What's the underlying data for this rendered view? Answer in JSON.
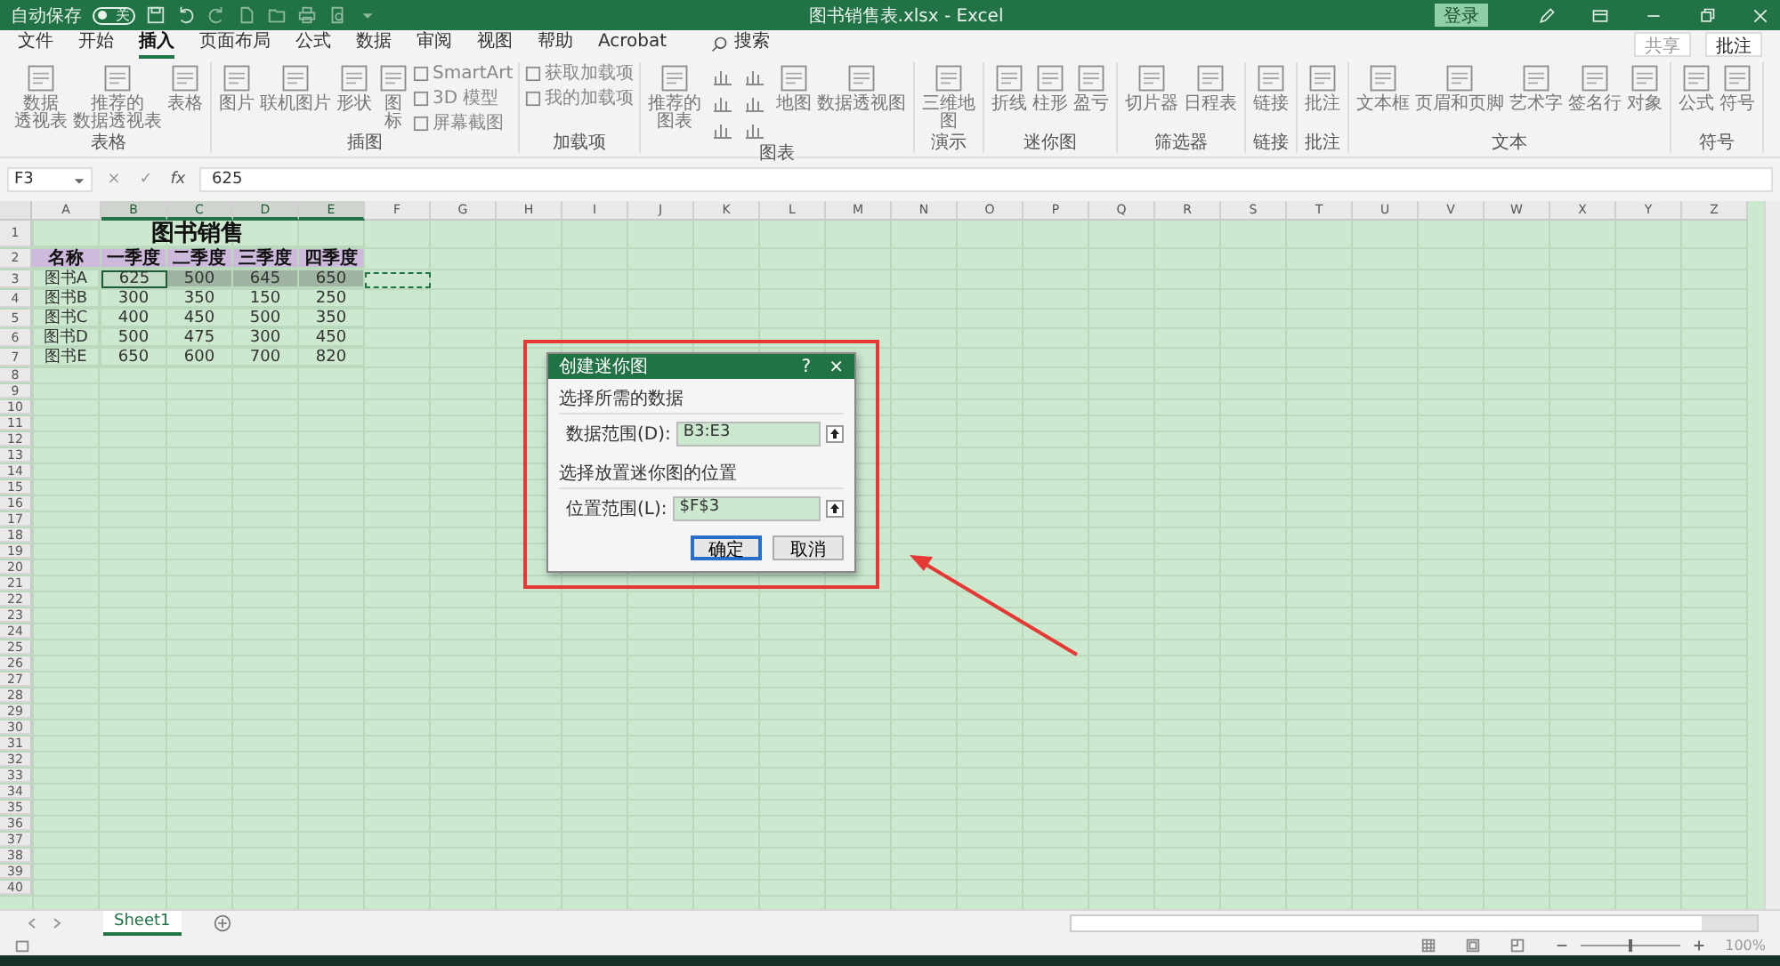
{
  "title_bar": {
    "autosave": {
      "label": "自动保存",
      "on": false,
      "state_text": "关"
    },
    "title": "图书销售表.xlsx - Excel",
    "sign_in": "登录"
  },
  "tabs": [
    {
      "label": "文件",
      "selected": false
    },
    {
      "label": "开始",
      "selected": false
    },
    {
      "label": "插入",
      "selected": true
    },
    {
      "label": "页面布局",
      "selected": false
    },
    {
      "label": "公式",
      "selected": false
    },
    {
      "label": "数据",
      "selected": false
    },
    {
      "label": "审阅",
      "selected": false
    },
    {
      "label": "视图",
      "selected": false
    },
    {
      "label": "帮助",
      "selected": false
    },
    {
      "label": "Acrobat",
      "selected": false
    }
  ],
  "search": {
    "label": "搜索"
  },
  "share": "共享",
  "comments": "批注",
  "ribbon": [
    {
      "label": "表格",
      "items": [
        {
          "kind": "large",
          "lines": [
            "数据",
            "透视表"
          ]
        },
        {
          "kind": "large",
          "lines": [
            "推荐的",
            "数据透视表"
          ]
        },
        {
          "kind": "large",
          "lines": [
            "表格"
          ]
        }
      ]
    },
    {
      "label": "插图",
      "items": [
        {
          "kind": "large",
          "lines": [
            "图片"
          ]
        },
        {
          "kind": "large",
          "lines": [
            "联机图片"
          ]
        },
        {
          "kind": "large",
          "lines": [
            "形状"
          ]
        },
        {
          "kind": "large",
          "lines": [
            "图",
            "标"
          ]
        },
        {
          "kind": "stack",
          "entries": [
            "SmartArt",
            "3D 模型",
            "屏幕截图"
          ]
        }
      ]
    },
    {
      "label": "加载项",
      "items": [
        {
          "kind": "stack",
          "entries": [
            "获取加载项",
            "我的加载项"
          ]
        }
      ]
    },
    {
      "label": "图表",
      "items": [
        {
          "kind": "large",
          "lines": [
            "推荐的",
            "图表"
          ]
        },
        {
          "kind": "gallery"
        },
        {
          "kind": "large",
          "lines": [
            "地图"
          ]
        },
        {
          "kind": "large",
          "lines": [
            "数据透视图"
          ]
        }
      ]
    },
    {
      "label": "演示",
      "items": [
        {
          "kind": "large",
          "lines": [
            "三维地",
            "图"
          ]
        }
      ]
    },
    {
      "label": "迷你图",
      "items": [
        {
          "kind": "large",
          "lines": [
            "折线"
          ]
        },
        {
          "kind": "large",
          "lines": [
            "柱形"
          ]
        },
        {
          "kind": "large",
          "lines": [
            "盈亏"
          ]
        }
      ]
    },
    {
      "label": "筛选器",
      "items": [
        {
          "kind": "large",
          "lines": [
            "切片器"
          ]
        },
        {
          "kind": "large",
          "lines": [
            "日程表"
          ]
        }
      ]
    },
    {
      "label": "链接",
      "items": [
        {
          "kind": "large",
          "lines": [
            "链接"
          ]
        }
      ]
    },
    {
      "label": "批注",
      "items": [
        {
          "kind": "large",
          "lines": [
            "批注"
          ]
        }
      ]
    },
    {
      "label": "文本",
      "items": [
        {
          "kind": "large",
          "lines": [
            "文本框"
          ]
        },
        {
          "kind": "large",
          "lines": [
            "页眉和页脚"
          ]
        },
        {
          "kind": "large",
          "lines": [
            "艺术字"
          ]
        },
        {
          "kind": "large",
          "lines": [
            "签名行"
          ]
        },
        {
          "kind": "large",
          "lines": [
            "对象"
          ]
        }
      ]
    },
    {
      "label": "符号",
      "items": [
        {
          "kind": "large",
          "lines": [
            "公式"
          ]
        },
        {
          "kind": "large",
          "lines": [
            "符号"
          ]
        }
      ]
    }
  ],
  "formula_bar": {
    "name_box": "F3",
    "cancel": "×",
    "enter": "✓",
    "fx": "fx",
    "value": "625"
  },
  "sheet": {
    "columns": [
      {
        "label": "A",
        "selected": false
      },
      {
        "label": "B",
        "selected": true
      },
      {
        "label": "C",
        "selected": true
      },
      {
        "label": "D",
        "selected": true
      },
      {
        "label": "E",
        "selected": true
      },
      {
        "label": "F",
        "selected": false
      },
      {
        "label": "G",
        "selected": false
      },
      {
        "label": "H",
        "selected": false
      },
      {
        "label": "I",
        "selected": false
      },
      {
        "label": "J",
        "selected": false
      },
      {
        "label": "K",
        "selected": false
      },
      {
        "label": "L",
        "selected": false
      },
      {
        "label": "M",
        "selected": false
      },
      {
        "label": "N",
        "selected": false
      },
      {
        "label": "O",
        "selected": false
      },
      {
        "label": "P",
        "selected": false
      },
      {
        "label": "Q",
        "selected": false
      },
      {
        "label": "R",
        "selected": false
      },
      {
        "label": "S",
        "selected": false
      },
      {
        "label": "T",
        "selected": false
      },
      {
        "label": "U",
        "selected": false
      },
      {
        "label": "V",
        "selected": false
      },
      {
        "label": "W",
        "selected": false
      },
      {
        "label": "X",
        "selected": false
      },
      {
        "label": "Y",
        "selected": false
      },
      {
        "label": "Z",
        "selected": false
      }
    ],
    "rows": [
      {
        "header": "1",
        "kind": "title",
        "cells": [
          {
            "text": "图书销售"
          }
        ]
      },
      {
        "header": "2",
        "kind": "header",
        "cells": [
          {
            "text": "名称"
          },
          {
            "text": "一季度"
          },
          {
            "text": "二季度"
          },
          {
            "text": "三季度"
          },
          {
            "text": "四季度"
          }
        ]
      },
      {
        "header": "3",
        "kind": "data",
        "marquee": true,
        "cells": [
          {
            "text": "图书A",
            "selected": false,
            "active": false
          },
          {
            "text": "625",
            "selected": true,
            "active": true
          },
          {
            "text": "500",
            "selected": true,
            "active": false
          },
          {
            "text": "645",
            "selected": true,
            "active": false
          },
          {
            "text": "650",
            "selected": true,
            "active": false
          }
        ]
      },
      {
        "header": "4",
        "kind": "data",
        "cells": [
          {
            "text": "图书B",
            "selected": false,
            "active": false
          },
          {
            "text": "300",
            "selected": false,
            "active": false
          },
          {
            "text": "350",
            "selected": false,
            "active": false
          },
          {
            "text": "150",
            "selected": false,
            "active": false
          },
          {
            "text": "250",
            "selected": false,
            "active": false
          }
        ]
      },
      {
        "header": "5",
        "kind": "data",
        "cells": [
          {
            "text": "图书C",
            "selected": false,
            "active": false
          },
          {
            "text": "400",
            "selected": false,
            "active": false
          },
          {
            "text": "450",
            "selected": false,
            "active": false
          },
          {
            "text": "500",
            "selected": false,
            "active": false
          },
          {
            "text": "350",
            "selected": false,
            "active": false
          }
        ]
      },
      {
        "header": "6",
        "kind": "data",
        "cells": [
          {
            "text": "图书D",
            "selected": false,
            "active": false
          },
          {
            "text": "500",
            "selected": false,
            "active": false
          },
          {
            "text": "475",
            "selected": false,
            "active": false
          },
          {
            "text": "300",
            "selected": false,
            "active": false
          },
          {
            "text": "450",
            "selected": false,
            "active": false
          }
        ]
      },
      {
        "header": "7",
        "kind": "data",
        "cells": [
          {
            "text": "图书E",
            "selected": false,
            "active": false
          },
          {
            "text": "650",
            "selected": false,
            "active": false
          },
          {
            "text": "600",
            "selected": false,
            "active": false
          },
          {
            "text": "700",
            "selected": false,
            "active": false
          },
          {
            "text": "820",
            "selected": false,
            "active": false
          }
        ]
      },
      {
        "header": "8",
        "kind": "empty"
      },
      {
        "header": "9",
        "kind": "empty"
      },
      {
        "header": "10",
        "kind": "empty"
      },
      {
        "header": "11",
        "kind": "empty"
      },
      {
        "header": "12",
        "kind": "empty"
      },
      {
        "header": "13",
        "kind": "empty"
      },
      {
        "header": "14",
        "kind": "empty"
      },
      {
        "header": "15",
        "kind": "empty"
      },
      {
        "header": "16",
        "kind": "empty"
      },
      {
        "header": "17",
        "kind": "empty"
      },
      {
        "header": "18",
        "kind": "empty"
      },
      {
        "header": "19",
        "kind": "empty"
      },
      {
        "header": "20",
        "kind": "empty"
      },
      {
        "header": "21",
        "kind": "empty"
      },
      {
        "header": "22",
        "kind": "empty"
      },
      {
        "header": "23",
        "kind": "empty"
      },
      {
        "header": "24",
        "kind": "empty"
      },
      {
        "header": "25",
        "kind": "empty"
      },
      {
        "header": "26",
        "kind": "empty"
      },
      {
        "header": "27",
        "kind": "empty"
      },
      {
        "header": "28",
        "kind": "empty"
      },
      {
        "header": "29",
        "kind": "empty"
      },
      {
        "header": "30",
        "kind": "empty"
      },
      {
        "header": "31",
        "kind": "empty"
      },
      {
        "header": "32",
        "kind": "empty"
      },
      {
        "header": "33",
        "kind": "empty"
      },
      {
        "header": "34",
        "kind": "empty"
      },
      {
        "header": "35",
        "kind": "empty"
      },
      {
        "header": "36",
        "kind": "empty"
      },
      {
        "header": "37",
        "kind": "empty"
      },
      {
        "header": "38",
        "kind": "empty"
      },
      {
        "header": "39",
        "kind": "empty"
      },
      {
        "header": "40",
        "kind": "empty"
      }
    ]
  },
  "dialog": {
    "title": "创建迷你图",
    "help": "?",
    "close": "×",
    "sections": [
      {
        "heading": "选择所需的数据",
        "label": "数据范围(D):",
        "value": "B3:E3"
      },
      {
        "heading": "选择放置迷你图的位置",
        "label": "位置范围(L):",
        "value": "$F$3"
      }
    ],
    "buttons": [
      {
        "label": "确定",
        "default": true
      },
      {
        "label": "取消",
        "default": false
      }
    ]
  },
  "sheet_tabs": [
    {
      "label": "Sheet1",
      "selected": true
    }
  ],
  "status_bar": {
    "zoom": {
      "level": 0.5,
      "reading": "100%"
    }
  }
}
